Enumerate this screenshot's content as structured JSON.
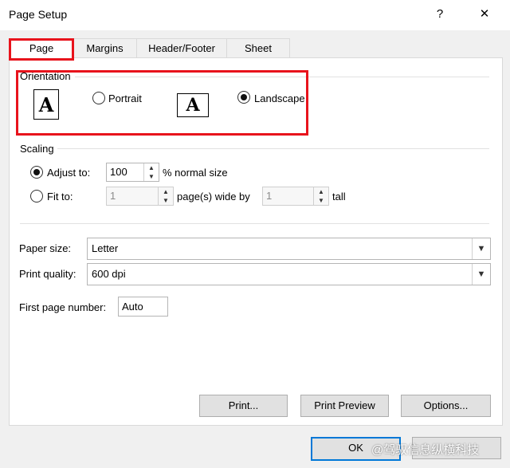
{
  "window": {
    "title": "Page Setup",
    "help": "?",
    "close": "✕"
  },
  "tabs": [
    {
      "label": "Page"
    },
    {
      "label": "Margins"
    },
    {
      "label": "Header/Footer"
    },
    {
      "label": "Sheet"
    }
  ],
  "orientation": {
    "section_label": "Orientation",
    "portrait_label": "Portrait",
    "landscape_label": "Landscape",
    "icon_letter": "A",
    "selected": "landscape"
  },
  "scaling": {
    "section_label": "Scaling",
    "adjust_label": "Adjust to:",
    "adjust_value": "100",
    "adjust_suffix": "% normal size",
    "fit_label": "Fit to:",
    "fit_wide_value": "1",
    "fit_wide_suffix": "page(s) wide by",
    "fit_tall_value": "1",
    "fit_tall_suffix": "tall",
    "selected": "adjust"
  },
  "paper": {
    "size_label": "Paper size:",
    "size_value": "Letter",
    "quality_label": "Print quality:",
    "quality_value": "600 dpi",
    "first_page_label": "First page number:",
    "first_page_value": "Auto"
  },
  "buttons": {
    "print": "Print...",
    "preview": "Print Preview",
    "options": "Options...",
    "ok": "OK"
  },
  "watermark": "@驾驭信息纵横科技",
  "colors": {
    "highlight": "#e8131c",
    "default_button": "#0078d7"
  }
}
